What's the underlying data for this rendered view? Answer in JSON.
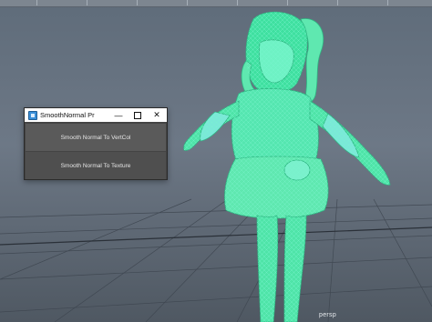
{
  "tool_window": {
    "title": "SmoothNormal Proc...",
    "minimize_glyph": "—",
    "close_glyph": "✕",
    "icon": "app-window-icon",
    "buttons": [
      {
        "label": "Smooth Normal To VertCol"
      },
      {
        "label": "Smooth Normal To Texture"
      }
    ]
  },
  "viewport": {
    "camera_label": "persp",
    "colors": {
      "wireframe": "#4ef0b8",
      "mesh_fill": "#3fe0a0",
      "mesh_shade": "#7ae8d8",
      "background": "#66717e"
    }
  }
}
